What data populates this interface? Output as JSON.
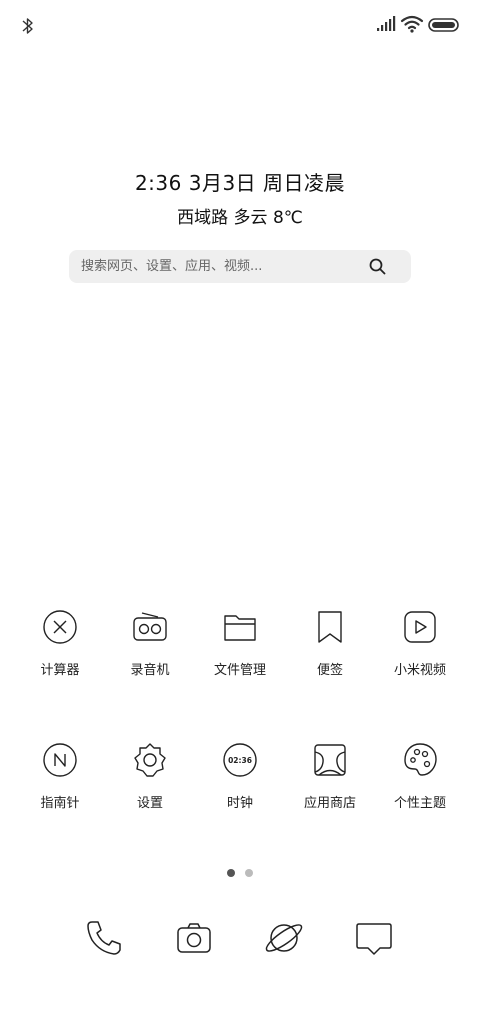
{
  "status_bar": {
    "bluetooth_icon": "bluetooth-icon",
    "signal_icon": "signal-icon",
    "wifi_icon": "wifi-icon",
    "battery_icon": "battery-icon"
  },
  "clock_widget": {
    "datetime": "2:36  3月3日 周日凌晨",
    "weather": "西域路 多云 8℃"
  },
  "search": {
    "placeholder": "搜索网页、设置、应用、视频...",
    "icon": "search-icon"
  },
  "apps": [
    {
      "label": "计算器",
      "icon": "calculator-icon"
    },
    {
      "label": "录音机",
      "icon": "recorder-icon"
    },
    {
      "label": "文件管理",
      "icon": "folder-icon"
    },
    {
      "label": "便签",
      "icon": "bookmark-icon"
    },
    {
      "label": "小米视频",
      "icon": "video-icon"
    },
    {
      "label": "指南针",
      "icon": "compass-icon"
    },
    {
      "label": "设置",
      "icon": "gear-icon"
    },
    {
      "label": "时钟",
      "icon": "clock-icon",
      "icon_text": "02:36"
    },
    {
      "label": "应用商店",
      "icon": "app-store-icon"
    },
    {
      "label": "个性主题",
      "icon": "palette-icon"
    }
  ],
  "pages": {
    "current": 1,
    "total": 2
  },
  "dock": [
    {
      "icon": "phone-icon"
    },
    {
      "icon": "camera-icon"
    },
    {
      "icon": "browser-icon"
    },
    {
      "icon": "message-icon"
    }
  ],
  "colors": {
    "background": "#ffffff",
    "search_bg": "#efefef",
    "icon_stroke": "#222222"
  }
}
